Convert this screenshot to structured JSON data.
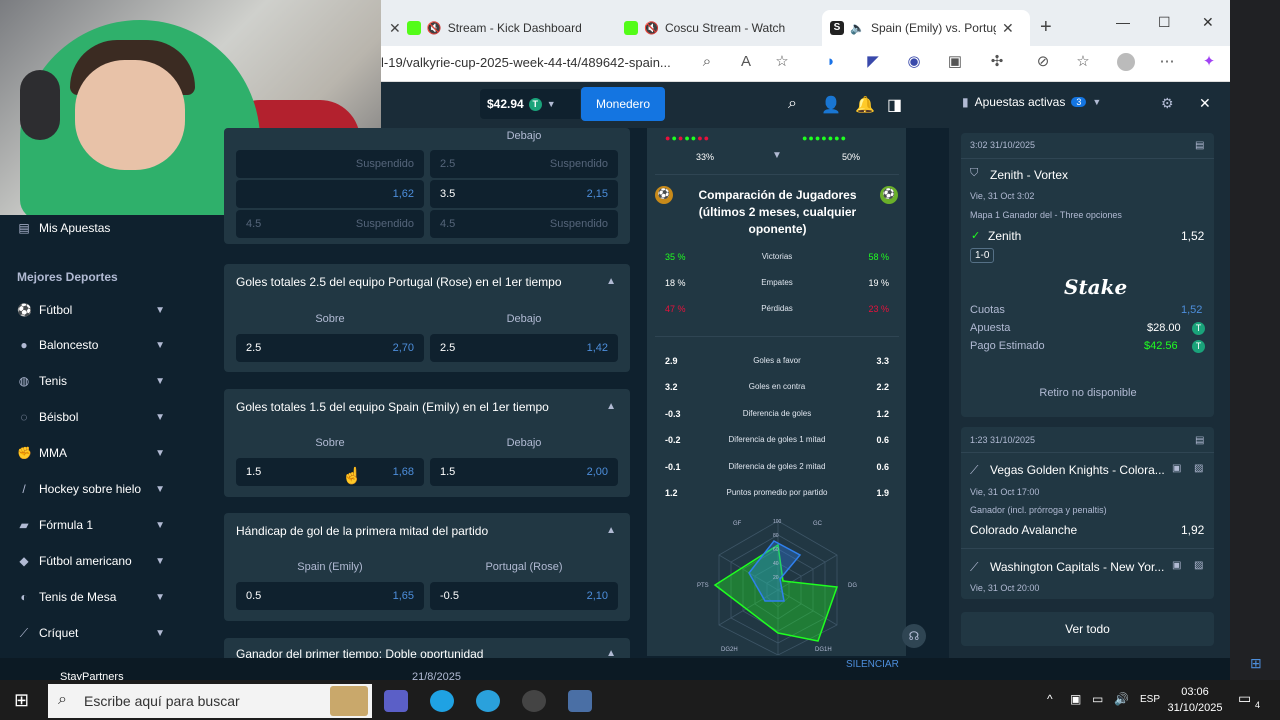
{
  "browser": {
    "tabs": [
      {
        "label": "Stream - Kick Dashboard"
      },
      {
        "label": "Coscu Stream - Watch Li"
      },
      {
        "label": "Spain (Emily) vs. Portug"
      }
    ],
    "url": "l-19/valkyrie-cup-2025-week-44-t4/489642-spain..."
  },
  "header": {
    "balance": "$42.94",
    "wallet_label": "Monedero"
  },
  "sidebar": {
    "my_bets": "Mis Apuestas",
    "section_title": "Mejores Deportes",
    "items": [
      {
        "label": "Fútbol"
      },
      {
        "label": "Baloncesto"
      },
      {
        "label": "Tenis"
      },
      {
        "label": "Béisbol"
      },
      {
        "label": "MMA"
      },
      {
        "label": "Hockey sobre hielo"
      },
      {
        "label": "Fórmula 1"
      },
      {
        "label": "Fútbol americano"
      },
      {
        "label": "Tenis de Mesa"
      },
      {
        "label": "Críquet"
      }
    ],
    "partner": "StayPartners"
  },
  "markets": {
    "top_partial": {
      "col_label": "Debajo",
      "rows": [
        {
          "l_left": "",
          "l_right": "Suspendido",
          "r_left": "2.5",
          "r_right": "Suspendido"
        },
        {
          "l_left": "",
          "l_right": "1,62",
          "r_left": "3.5",
          "r_right": "2,15"
        },
        {
          "l_left": "4.5",
          "l_right": "Suspendido",
          "r_left": "4.5",
          "r_right": "Suspendido"
        }
      ]
    },
    "m1": {
      "title": "Goles totales 2.5 del equipo Portugal (Rose) en el 1er tiempo",
      "col_a": "Sobre",
      "col_b": "Debajo",
      "a_line": "2.5",
      "a_odd": "2,70",
      "b_line": "2.5",
      "b_odd": "1,42"
    },
    "m2": {
      "title": "Goles totales 1.5 del equipo Spain (Emily) en el 1er tiempo",
      "col_a": "Sobre",
      "col_b": "Debajo",
      "a_line": "1.5",
      "a_odd": "1,68",
      "b_line": "1.5",
      "b_odd": "2,00"
    },
    "m3": {
      "title": "Hándicap de gol de la primera mitad del partido",
      "col_a": "Spain (Emily)",
      "col_b": "Portugal (Rose)",
      "a_line": "0.5",
      "a_odd": "1,65",
      "b_line": "-0.5",
      "b_odd": "2,10"
    },
    "m4": {
      "title": "Ganador del primer tiempo: Doble oportunidad"
    },
    "date_below": "21/8/2025"
  },
  "stats": {
    "form_left": "33%",
    "form_right": "50%",
    "title": "Comparación de Jugadores (últimos 2 meses, cualquier oponente)",
    "top_rows": [
      {
        "a": "35 %",
        "label": "Victorias",
        "b": "58 %"
      },
      {
        "a": "18 %",
        "label": "Empates",
        "b": "19 %"
      },
      {
        "a": "47 %",
        "label": "Pérdidas",
        "b": "23 %"
      }
    ],
    "rows": [
      {
        "a": "2.9",
        "label": "Goles a favor",
        "b": "3.3"
      },
      {
        "a": "3.2",
        "label": "Goles en contra",
        "b": "2.2"
      },
      {
        "a": "-0.3",
        "label": "Diferencia de goles",
        "b": "1.2"
      },
      {
        "a": "-0.2",
        "label": "Diferencia de goles 1 mitad",
        "b": "0.6"
      },
      {
        "a": "-0.1",
        "label": "Diferencia de goles 2 mitad",
        "b": "0.6"
      },
      {
        "a": "1.2",
        "label": "Puntos promedio por partido",
        "b": "1.9"
      }
    ],
    "radar_labels": [
      "GF",
      "GC",
      "DG",
      "DG1H",
      "DG2H",
      "PTS"
    ],
    "radar_ticks": [
      "100",
      "80",
      "60",
      "40",
      "20"
    ]
  },
  "bets": {
    "title": "Apuestas activas",
    "count": "3",
    "slip1": {
      "time": "3:02 31/10/2025",
      "match": "Zenith - Vortex",
      "date": "Vie, 31 Oct 3:02",
      "market": "Mapa 1 Ganador del - Three opciones",
      "pick": "Zenith",
      "pick_odd": "1,52",
      "score": "1-0",
      "brand": "Stake",
      "cuotas_label": "Cuotas",
      "cuotas_val": "1,52",
      "apuesta_label": "Apuesta",
      "apuesta_val": "$28.00",
      "pago_label": "Pago Estimado",
      "pago_val": "$42.56",
      "retiro": "Retiro no disponible"
    },
    "slip2": {
      "time": "1:23 31/10/2025",
      "match1": "Vegas Golden Knights - Colora...",
      "date1": "Vie, 31 Oct 17:00",
      "market1": "Ganador (incl. prórroga y penaltis)",
      "pick1": "Colorado Avalanche",
      "pick1_odd": "1,92",
      "match2": "Washington Capitals - New Yor...",
      "date2": "Vie, 31 Oct 20:00"
    },
    "view_all": "Ver todo"
  },
  "overlay": {
    "silenciar": "SILENCIAR"
  },
  "taskbar": {
    "search_placeholder": "Escribe aquí para buscar",
    "lang": "ESP",
    "time": "03:06",
    "date": "31/10/2025",
    "notif": "4"
  }
}
